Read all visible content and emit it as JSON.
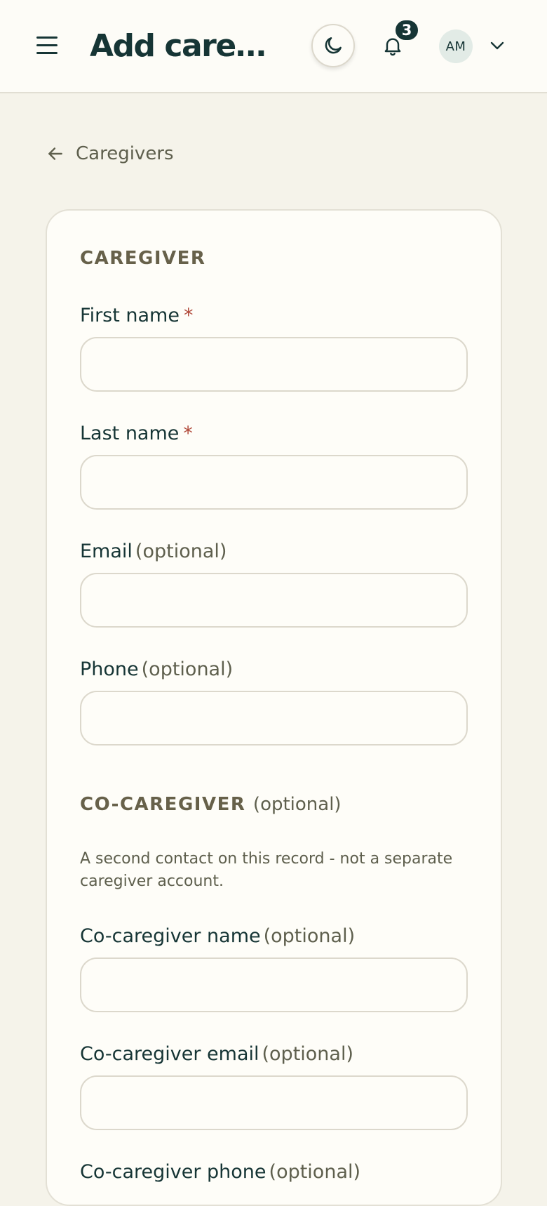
{
  "header": {
    "title": "Add caregi...",
    "notification_count": "3",
    "avatar_initials": "AM",
    "icons": [
      "menu-icon",
      "moon-icon",
      "bell-icon",
      "chevron-down-icon"
    ]
  },
  "breadcrumb": {
    "back_label": "Caregivers"
  },
  "form": {
    "caregiver_section": {
      "title": "CAREGIVER"
    },
    "fields": {
      "first_name": {
        "label": "First name",
        "required_mark": "*",
        "value": ""
      },
      "last_name": {
        "label": "Last name",
        "required_mark": "*",
        "value": ""
      },
      "email": {
        "label": "Email",
        "optional_text": "(optional)",
        "value": ""
      },
      "phone": {
        "label": "Phone",
        "optional_text": "(optional)",
        "value": ""
      }
    },
    "co_caregiver_section": {
      "title": "CO-CAREGIVER",
      "optional_text": "(optional)",
      "help": "A second contact on this record - not a separate caregiver account."
    },
    "co_fields": {
      "name": {
        "label": "Co-caregiver name",
        "optional_text": "(optional)",
        "value": ""
      },
      "email": {
        "label": "Co-caregiver email",
        "optional_text": "(optional)",
        "value": ""
      },
      "phone": {
        "label": "Co-caregiver phone",
        "optional_text": "(optional)",
        "value": ""
      }
    }
  },
  "colors": {
    "page_background": "#f5f3ea",
    "surface": "#fdfcf7",
    "primary": "#163535",
    "required": "#b14a3b",
    "muted_text": "#5e5f4d",
    "border": "#dcd8cc"
  }
}
